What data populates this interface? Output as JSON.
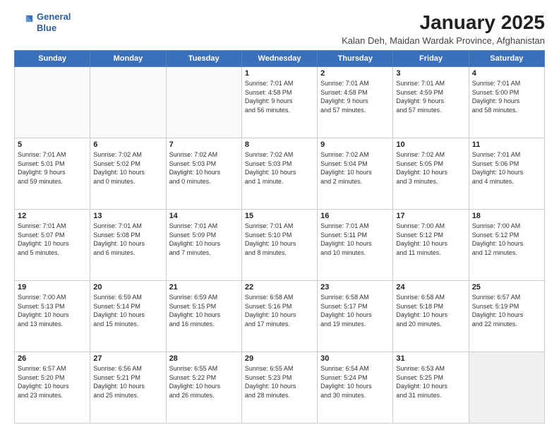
{
  "logo": {
    "line1": "General",
    "line2": "Blue"
  },
  "title": "January 2025",
  "subtitle": "Kalan Deh, Maidan Wardak Province, Afghanistan",
  "weekdays": [
    "Sunday",
    "Monday",
    "Tuesday",
    "Wednesday",
    "Thursday",
    "Friday",
    "Saturday"
  ],
  "weeks": [
    [
      {
        "day": "",
        "info": ""
      },
      {
        "day": "",
        "info": ""
      },
      {
        "day": "",
        "info": ""
      },
      {
        "day": "1",
        "info": "Sunrise: 7:01 AM\nSunset: 4:58 PM\nDaylight: 9 hours\nand 56 minutes."
      },
      {
        "day": "2",
        "info": "Sunrise: 7:01 AM\nSunset: 4:58 PM\nDaylight: 9 hours\nand 57 minutes."
      },
      {
        "day": "3",
        "info": "Sunrise: 7:01 AM\nSunset: 4:59 PM\nDaylight: 9 hours\nand 57 minutes."
      },
      {
        "day": "4",
        "info": "Sunrise: 7:01 AM\nSunset: 5:00 PM\nDaylight: 9 hours\nand 58 minutes."
      }
    ],
    [
      {
        "day": "5",
        "info": "Sunrise: 7:01 AM\nSunset: 5:01 PM\nDaylight: 9 hours\nand 59 minutes."
      },
      {
        "day": "6",
        "info": "Sunrise: 7:02 AM\nSunset: 5:02 PM\nDaylight: 10 hours\nand 0 minutes."
      },
      {
        "day": "7",
        "info": "Sunrise: 7:02 AM\nSunset: 5:03 PM\nDaylight: 10 hours\nand 0 minutes."
      },
      {
        "day": "8",
        "info": "Sunrise: 7:02 AM\nSunset: 5:03 PM\nDaylight: 10 hours\nand 1 minute."
      },
      {
        "day": "9",
        "info": "Sunrise: 7:02 AM\nSunset: 5:04 PM\nDaylight: 10 hours\nand 2 minutes."
      },
      {
        "day": "10",
        "info": "Sunrise: 7:02 AM\nSunset: 5:05 PM\nDaylight: 10 hours\nand 3 minutes."
      },
      {
        "day": "11",
        "info": "Sunrise: 7:01 AM\nSunset: 5:06 PM\nDaylight: 10 hours\nand 4 minutes."
      }
    ],
    [
      {
        "day": "12",
        "info": "Sunrise: 7:01 AM\nSunset: 5:07 PM\nDaylight: 10 hours\nand 5 minutes."
      },
      {
        "day": "13",
        "info": "Sunrise: 7:01 AM\nSunset: 5:08 PM\nDaylight: 10 hours\nand 6 minutes."
      },
      {
        "day": "14",
        "info": "Sunrise: 7:01 AM\nSunset: 5:09 PM\nDaylight: 10 hours\nand 7 minutes."
      },
      {
        "day": "15",
        "info": "Sunrise: 7:01 AM\nSunset: 5:10 PM\nDaylight: 10 hours\nand 8 minutes."
      },
      {
        "day": "16",
        "info": "Sunrise: 7:01 AM\nSunset: 5:11 PM\nDaylight: 10 hours\nand 10 minutes."
      },
      {
        "day": "17",
        "info": "Sunrise: 7:00 AM\nSunset: 5:12 PM\nDaylight: 10 hours\nand 11 minutes."
      },
      {
        "day": "18",
        "info": "Sunrise: 7:00 AM\nSunset: 5:12 PM\nDaylight: 10 hours\nand 12 minutes."
      }
    ],
    [
      {
        "day": "19",
        "info": "Sunrise: 7:00 AM\nSunset: 5:13 PM\nDaylight: 10 hours\nand 13 minutes."
      },
      {
        "day": "20",
        "info": "Sunrise: 6:59 AM\nSunset: 5:14 PM\nDaylight: 10 hours\nand 15 minutes."
      },
      {
        "day": "21",
        "info": "Sunrise: 6:59 AM\nSunset: 5:15 PM\nDaylight: 10 hours\nand 16 minutes."
      },
      {
        "day": "22",
        "info": "Sunrise: 6:58 AM\nSunset: 5:16 PM\nDaylight: 10 hours\nand 17 minutes."
      },
      {
        "day": "23",
        "info": "Sunrise: 6:58 AM\nSunset: 5:17 PM\nDaylight: 10 hours\nand 19 minutes."
      },
      {
        "day": "24",
        "info": "Sunrise: 6:58 AM\nSunset: 5:18 PM\nDaylight: 10 hours\nand 20 minutes."
      },
      {
        "day": "25",
        "info": "Sunrise: 6:57 AM\nSunset: 5:19 PM\nDaylight: 10 hours\nand 22 minutes."
      }
    ],
    [
      {
        "day": "26",
        "info": "Sunrise: 6:57 AM\nSunset: 5:20 PM\nDaylight: 10 hours\nand 23 minutes."
      },
      {
        "day": "27",
        "info": "Sunrise: 6:56 AM\nSunset: 5:21 PM\nDaylight: 10 hours\nand 25 minutes."
      },
      {
        "day": "28",
        "info": "Sunrise: 6:55 AM\nSunset: 5:22 PM\nDaylight: 10 hours\nand 26 minutes."
      },
      {
        "day": "29",
        "info": "Sunrise: 6:55 AM\nSunset: 5:23 PM\nDaylight: 10 hours\nand 28 minutes."
      },
      {
        "day": "30",
        "info": "Sunrise: 6:54 AM\nSunset: 5:24 PM\nDaylight: 10 hours\nand 30 minutes."
      },
      {
        "day": "31",
        "info": "Sunrise: 6:53 AM\nSunset: 5:25 PM\nDaylight: 10 hours\nand 31 minutes."
      },
      {
        "day": "",
        "info": ""
      }
    ]
  ]
}
